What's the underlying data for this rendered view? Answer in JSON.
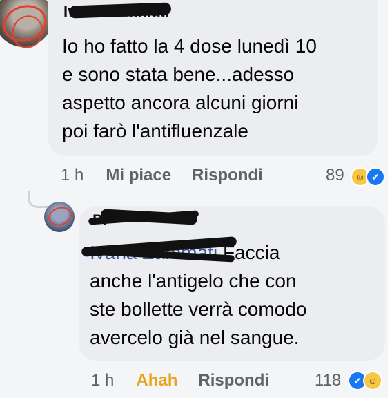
{
  "comments": [
    {
      "author": "Ivana Zammati",
      "text": "Io ho fatto la 4 dose lunedì 10\ne sono stata bene...adesso\naspetto ancora alcuni giorni\npoi farò  l'antifluenzale",
      "time": "1 h",
      "reaction_label": "Mi piace",
      "reply_label": "Rispondi",
      "reaction_count": "89",
      "reaction_icons": [
        "haha",
        "like"
      ]
    },
    {
      "author": "Pi",
      "mention": "Ivana Zammati",
      "text": "Faccia\nanche l'antigelo che con\nste bollette verrà comodo\navercelo già nel sangue.",
      "time": "1 h",
      "reaction_label": "Ahah",
      "reply_label": "Rispondi",
      "reaction_count": "118",
      "reaction_icons": [
        "like",
        "haha"
      ]
    }
  ],
  "colors": {
    "bubble": "#ebedf0",
    "mention": "#385898",
    "haha": "#e6a517",
    "like": "#1877f2",
    "redaction": "#111111"
  }
}
